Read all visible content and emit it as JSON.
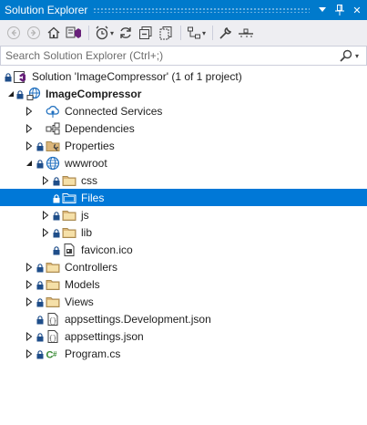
{
  "window": {
    "title": "Solution Explorer",
    "pin_label": "▾",
    "pin_icon": "pin-icon",
    "close_label": "✕"
  },
  "colors": {
    "titlebar": "#007acc",
    "selection": "#0078d7",
    "folder": "#dcb67a",
    "lock": "#1f4e8a"
  },
  "search": {
    "placeholder": "Search Solution Explorer (Ctrl+;)",
    "value": ""
  },
  "toolbar": {
    "buttons": [
      "back-icon",
      "forward-icon",
      "home-icon",
      "switch-views-icon",
      "pending-changes-icon",
      "sync-icon",
      "collapse-all-icon",
      "show-all-files-icon",
      "preview-icon",
      "properties-icon",
      "settings-icon"
    ]
  },
  "tree": {
    "items": [
      {
        "label": "Solution 'ImageCompressor' (1 of 1 project)"
      },
      {
        "label": "ImageCompressor"
      },
      {
        "label": "Connected Services"
      },
      {
        "label": "Dependencies"
      },
      {
        "label": "Properties"
      },
      {
        "label": "wwwroot"
      },
      {
        "label": "css"
      },
      {
        "label": "Files"
      },
      {
        "label": "js"
      },
      {
        "label": "lib"
      },
      {
        "label": "favicon.ico"
      },
      {
        "label": "Controllers"
      },
      {
        "label": "Models"
      },
      {
        "label": "Views"
      },
      {
        "label": "appsettings.Development.json"
      },
      {
        "label": "appsettings.json"
      },
      {
        "label": "Program.cs"
      }
    ]
  }
}
